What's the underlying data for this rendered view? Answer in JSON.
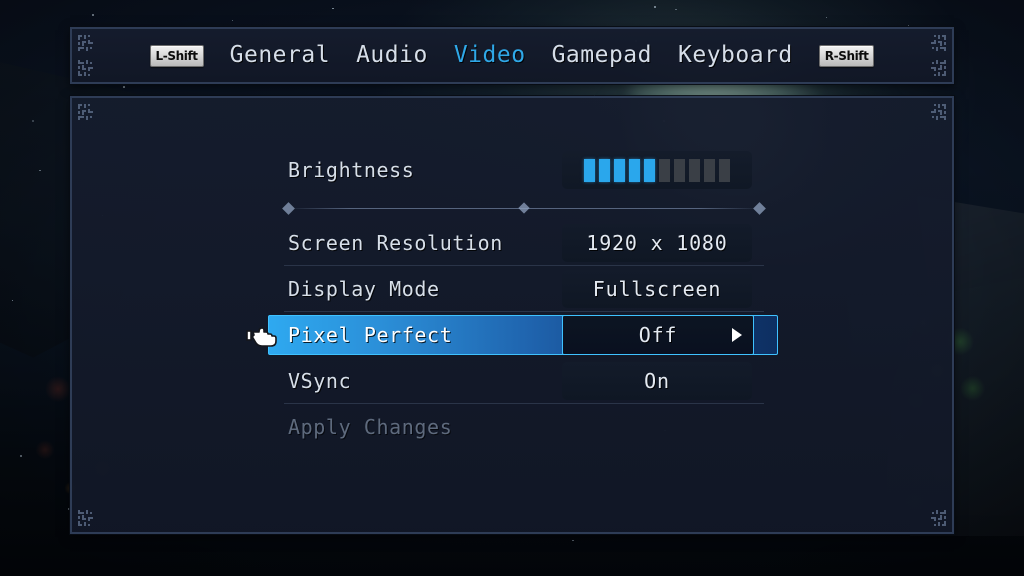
{
  "scene": {
    "description": "night-sky-background",
    "accent_color": "#2fa8e8",
    "panel_border_color": "#2e3c56"
  },
  "navbar": {
    "left_key_badge": "L-Shift",
    "right_key_badge": "R-Shift",
    "tabs": [
      {
        "label": "General",
        "active": false
      },
      {
        "label": "Audio",
        "active": false
      },
      {
        "label": "Video",
        "active": true
      },
      {
        "label": "Gamepad",
        "active": false
      },
      {
        "label": "Keyboard",
        "active": false
      }
    ]
  },
  "settings": {
    "brightness": {
      "label": "Brightness",
      "segments_total": 10,
      "segments_filled": 5,
      "filled_color": "#2aa7ec",
      "empty_color": "#3a3f46"
    },
    "rows": [
      {
        "label": "Screen Resolution",
        "value": "1920 x 1080",
        "selected": false,
        "disabled": false,
        "has_arrow": false
      },
      {
        "label": "Display Mode",
        "value": "Fullscreen",
        "selected": false,
        "disabled": false,
        "has_arrow": false
      },
      {
        "label": "Pixel Perfect",
        "value": "Off",
        "selected": true,
        "disabled": false,
        "has_arrow": true
      },
      {
        "label": "VSync",
        "value": "On",
        "selected": false,
        "disabled": false,
        "has_arrow": false
      },
      {
        "label": "Apply Changes",
        "value": "",
        "selected": false,
        "disabled": true,
        "has_arrow": false
      }
    ]
  },
  "cursor": {
    "type": "pointing-hand",
    "points_to": "Pixel Perfect"
  }
}
